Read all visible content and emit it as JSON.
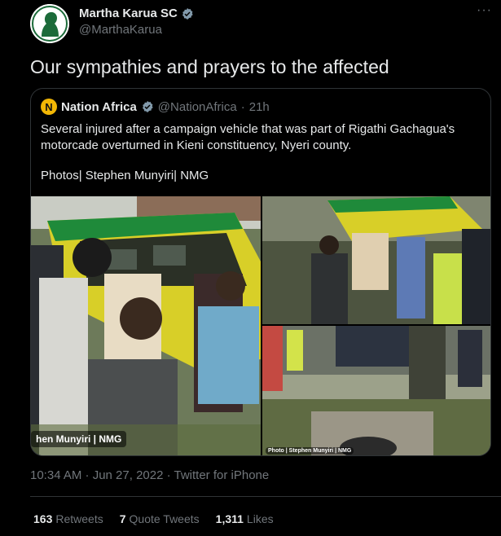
{
  "author": {
    "name": "Martha Karua SC",
    "handle": "@MarthaKarua",
    "avatar_icon": "silhouette-portrait"
  },
  "tweet": {
    "text": "Our sympathies and prayers to the affected",
    "more_icon": "···"
  },
  "quoted": {
    "logo_letter": "N",
    "name": "Nation Africa",
    "handle": "@NationAfrica",
    "separator": "·",
    "time": "21h",
    "body": "Several injured after a campaign vehicle that was part of Rigathi Gachagua's motorcade overturned in Kieni constituency, Nyeri county.",
    "credit": "Photos| Stephen Munyiri| NMG",
    "image_caption": "hen Munyiri | NMG",
    "image_caption_small": "Photo | Stephen Munyiri | NMG"
  },
  "meta": {
    "timestamp": "10:34 AM · Jun 27, 2022 · Twitter for iPhone"
  },
  "stats": {
    "retweets_count": "163",
    "retweets_label": "Retweets",
    "quotes_count": "7",
    "quotes_label": "Quote Tweets",
    "likes_count": "1,311",
    "likes_label": "Likes"
  },
  "colors": {
    "background": "#000000",
    "text": "#e7e9ea",
    "muted": "#71767b",
    "verified": "#829aab",
    "bus_yellow": "#e6d21a",
    "bus_green": "#1f8a3a"
  }
}
